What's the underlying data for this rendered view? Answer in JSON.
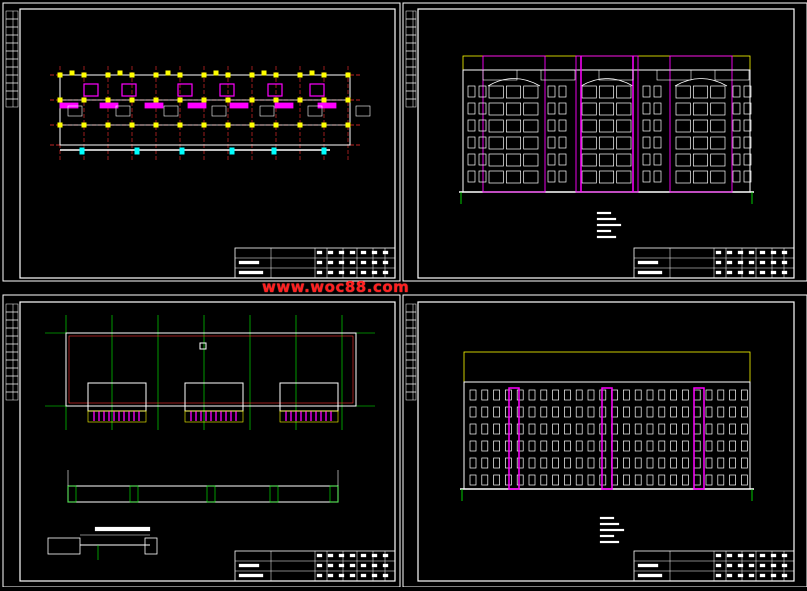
{
  "watermark": "www.woc88.com",
  "colors": {
    "background": "#000000",
    "frame": "#ffffff",
    "column": "#ffff00",
    "grid_axis": "#ff3030",
    "wall": "#ffffff",
    "highlight": "#ff00ff",
    "dimension": "#00ff00",
    "cyan": "#00ffff",
    "watermark": "#ff2020"
  },
  "sheets": [
    {
      "id": "sheet-1",
      "content": "floor-plan"
    },
    {
      "id": "sheet-2",
      "content": "front-elevation"
    },
    {
      "id": "sheet-3",
      "content": "roof-plan-and-details"
    },
    {
      "id": "sheet-4",
      "content": "rear-elevation"
    }
  ]
}
